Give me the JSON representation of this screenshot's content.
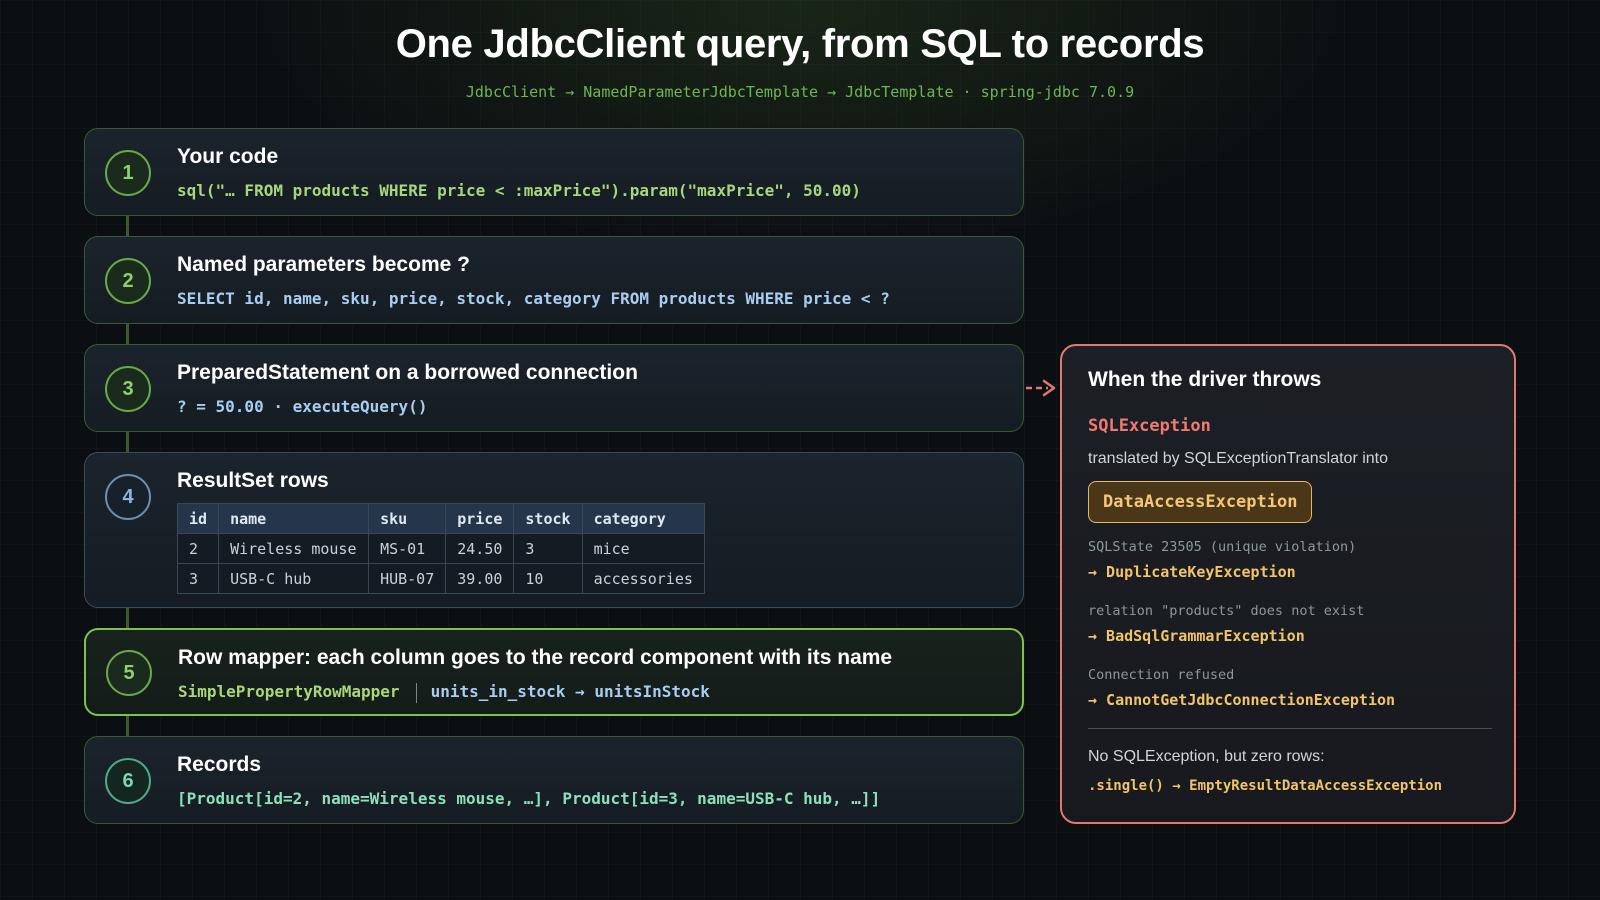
{
  "header": {
    "title": "One JdbcClient query, from SQL to records",
    "subtitle": "JdbcClient → NamedParameterJdbcTemplate → JdbcTemplate · spring-jdbc 7.0.9"
  },
  "steps": [
    {
      "number": "1",
      "title": "Your code",
      "code": "sql(\"… FROM products WHERE price < :maxPrice\").param(\"maxPrice\", 50.00)"
    },
    {
      "number": "2",
      "title": "Named parameters become ?",
      "code": "SELECT id, name, sku, price, stock, category FROM products WHERE price < ?"
    },
    {
      "number": "3",
      "title": "PreparedStatement on a borrowed connection",
      "code": "? = 50.00 · executeQuery()"
    },
    {
      "number": "4",
      "title": "ResultSet rows"
    },
    {
      "number": "5",
      "title": "Row mapper: each column goes to the record component with its name",
      "code_left": "SimplePropertyRowMapper",
      "code_right": "units_in_stock → unitsInStock"
    },
    {
      "number": "6",
      "title": "Records",
      "code": "[Product[id=2, name=Wireless mouse, …], Product[id=3, name=USB-C hub, …]]"
    }
  ],
  "result_set": {
    "columns": [
      "id",
      "name",
      "sku",
      "price",
      "stock",
      "category"
    ],
    "rows": [
      [
        "2",
        "Wireless mouse",
        "MS-01",
        "24.50",
        "3",
        "mice"
      ],
      [
        "3",
        "USB-C hub",
        "HUB-07",
        "39.00",
        "10",
        "accessories"
      ]
    ]
  },
  "error_panel": {
    "title": "When the driver throws",
    "exception": "SQLException",
    "translated_text": "translated by SQLExceptionTranslator into",
    "target_exception": "DataAccessException",
    "mappings": [
      {
        "cause": "SQLState 23505 (unique violation)",
        "result": "→ DuplicateKeyException"
      },
      {
        "cause": "relation \"products\" does not exist",
        "result": "→ BadSqlGrammarException"
      },
      {
        "cause": "Connection refused",
        "result": "→ CannotGetJdbcConnectionException"
      }
    ],
    "zero_rows_text": "No SQLException, but zero rows:",
    "zero_rows_code": ".single() → EmptyResultDataAccessException"
  },
  "colors": {
    "step_accent": "#7cc24e",
    "error_accent": "#e07a6e",
    "warning_accent": "#f2c46a"
  }
}
